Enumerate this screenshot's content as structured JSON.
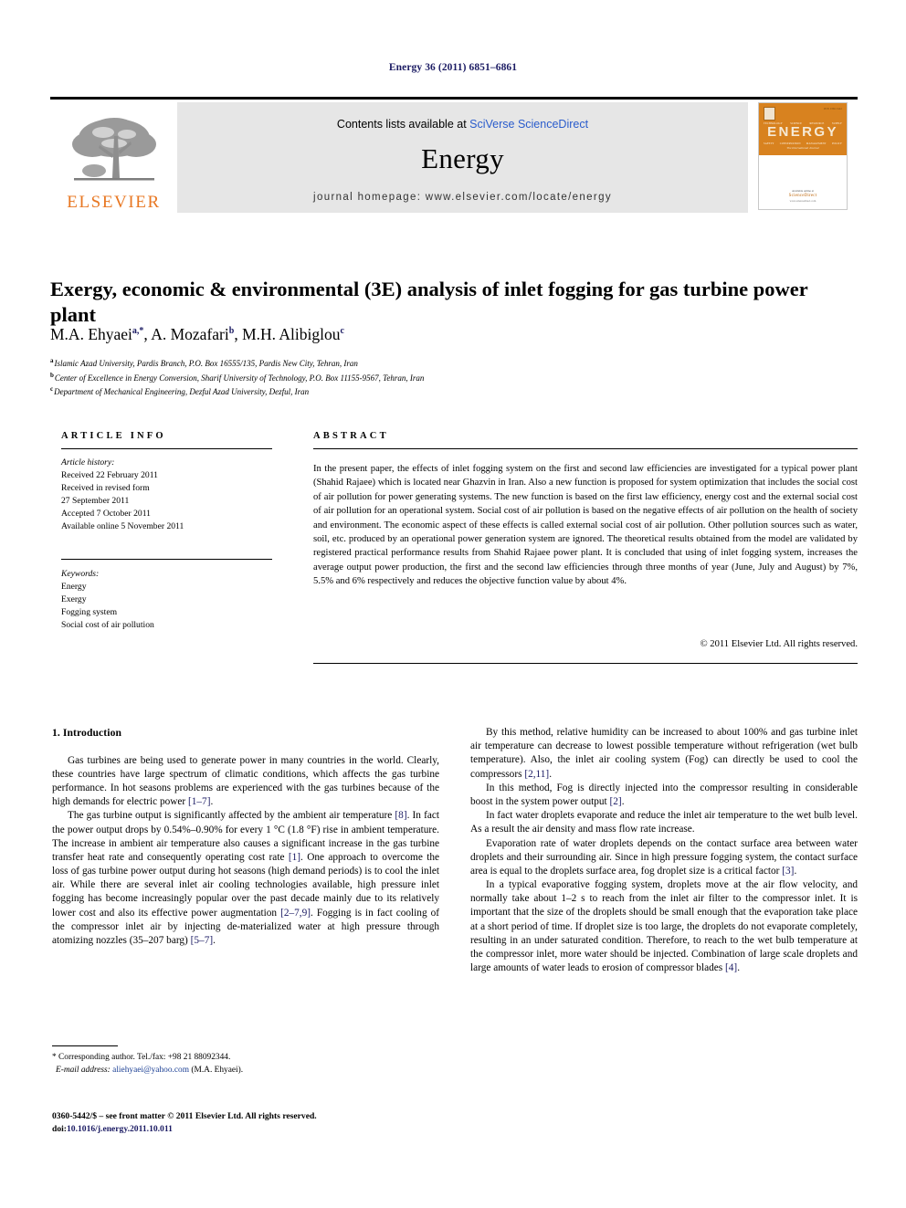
{
  "running_head": "Energy 36 (2011) 6851–6861",
  "masthead": {
    "contents_prefix": "Contents lists available at ",
    "contents_link": "SciVerse ScienceDirect",
    "journal_name": "Energy",
    "homepage": "journal homepage: www.elsevier.com/locate/energy",
    "publisher_wordmark": "ELSEVIER",
    "cover": {
      "title": "ENERGY",
      "subtitle": "The International Journal",
      "isbn_text": "ISSN 0360-5442",
      "top_row": [
        "TECHNOLOGY",
        "SCIENCE",
        "RESOURCE",
        "SUPPLY"
      ],
      "bottom_row": [
        "SAFETY",
        "CONSERVATION",
        "MANAGEMENT",
        "POLICY"
      ],
      "available_text": "Available online at",
      "sd_text": "ScienceDirect",
      "url_text": "www.sciencedirect.com"
    }
  },
  "article": {
    "title": "Exergy, economic & environmental (3E) analysis of inlet fogging for gas turbine power plant",
    "authors": [
      {
        "name": "M.A. Ehyaei",
        "marks": "a,*"
      },
      {
        "name": "A. Mozafari",
        "marks": "b"
      },
      {
        "name": "M.H. Alibiglou",
        "marks": "c"
      }
    ],
    "affiliations": [
      {
        "mark": "a",
        "text": "Islamic Azad University, Pardis Branch, P.O. Box 16555/135, Pardis New City, Tehran, Iran"
      },
      {
        "mark": "b",
        "text": "Center of Excellence in Energy Conversion, Sharif University of Technology, P.O. Box 11155-9567, Tehran, Iran"
      },
      {
        "mark": "c",
        "text": "Department of Mechanical Engineering, Dezful Azad University, Dezful, Iran"
      }
    ]
  },
  "info": {
    "label_article_info": "ARTICLE INFO",
    "label_abstract": "ABSTRACT",
    "history_title": "Article history:",
    "history_lines": [
      "Received 22 February 2011",
      "Received in revised form",
      "27 September 2011",
      "Accepted 7 October 2011",
      "Available online 5 November 2011"
    ],
    "keywords_title": "Keywords:",
    "keywords": [
      "Energy",
      "Exergy",
      "Fogging system",
      "Social cost of air pollution"
    ]
  },
  "abstract": {
    "text": "In the present paper, the effects of inlet fogging system on the first and second law efficiencies are investigated for a typical power plant (Shahid Rajaee) which is located near Ghazvin in Iran. Also a new function is proposed for system optimization that includes the social cost of air pollution for power generating systems. The new function is based on the first law efficiency, energy cost and the external social cost of air pollution for an operational system. Social cost of air pollution is based on the negative effects of air pollution on the health of society and environment. The economic aspect of these effects is called external social cost of air pollution. Other pollution sources such as water, soil, etc. produced by an operational power generation system are ignored. The theoretical results obtained from the model are validated by registered practical performance results from Shahid Rajaee power plant. It is concluded that using of inlet fogging system, increases the average output power production, the first and the second law efficiencies through three months of year (June, July and August) by 7%, 5.5% and 6% respectively and reduces the objective function value by about 4%.",
    "copyright": "© 2011 Elsevier Ltd. All rights reserved."
  },
  "body": {
    "section_heading": "1. Introduction",
    "left_paragraphs": [
      {
        "segments": [
          {
            "t": "Gas turbines are being used to generate power in many countries in the world. Clearly, these countries have large spectrum of climatic conditions, which affects the gas turbine performance. In hot seasons problems are experienced with the gas turbines because of the high demands for electric power "
          },
          {
            "t": "[1–7]",
            "ref": true
          },
          {
            "t": "."
          }
        ]
      },
      {
        "segments": [
          {
            "t": "The gas turbine output is significantly affected by the ambient air temperature "
          },
          {
            "t": "[8]",
            "ref": true
          },
          {
            "t": ". In fact the power output drops by 0.54%–0.90% for every 1 °C (1.8 °F) rise in ambient temperature. The increase in ambient air temperature also causes a significant increase in the gas turbine transfer heat rate and consequently operating cost rate "
          },
          {
            "t": "[1]",
            "ref": true
          },
          {
            "t": ". One approach to overcome the loss of gas turbine power output during hot seasons (high demand periods) is to cool the inlet air. While there are several inlet air cooling technologies available, high pressure inlet fogging has become increasingly popular over the past decade mainly due to its relatively lower cost and also its effective power augmentation "
          },
          {
            "t": "[2–7,9]",
            "ref": true
          },
          {
            "t": ". Fogging is in fact cooling of the compressor inlet air by injecting de-materialized water at high pressure through atomizing nozzles (35–207 barg) "
          },
          {
            "t": "[5–7]",
            "ref": true
          },
          {
            "t": "."
          }
        ]
      }
    ],
    "right_paragraphs": [
      {
        "segments": [
          {
            "t": "By this method, relative humidity can be increased to about 100% and gas turbine inlet air temperature can decrease to lowest possible temperature without refrigeration (wet bulb temperature). Also, the inlet air cooling system (Fog) can directly be used to cool the compressors "
          },
          {
            "t": "[2,11]",
            "ref": true
          },
          {
            "t": "."
          }
        ]
      },
      {
        "segments": [
          {
            "t": "In this method, Fog is directly injected into the compressor resulting in considerable boost in the system power output "
          },
          {
            "t": "[2]",
            "ref": true
          },
          {
            "t": "."
          }
        ]
      },
      {
        "segments": [
          {
            "t": "In fact water droplets evaporate and reduce the inlet air temperature to the wet bulb level. As a result the air density and mass flow rate increase."
          }
        ]
      },
      {
        "segments": [
          {
            "t": "Evaporation rate of water droplets depends on the contact surface area between water droplets and their surrounding air. Since in high pressure fogging system, the contact surface area is equal to the droplets surface area, fog droplet size is a critical factor "
          },
          {
            "t": "[3]",
            "ref": true
          },
          {
            "t": "."
          }
        ]
      },
      {
        "segments": [
          {
            "t": "In a typical evaporative fogging system, droplets move at the air flow velocity, and normally take about 1–2 s to reach from the inlet air filter to the compressor inlet. It is important that the size of the droplets should be small enough that the evaporation take place at a short period of time. If droplet size is too large, the droplets do not evaporate completely, resulting in an under saturated condition. Therefore, to reach to the wet bulb temperature at the compressor inlet, more water should be injected. Combination of large scale droplets and large amounts of water leads to erosion of compressor blades "
          },
          {
            "t": "[4]",
            "ref": true
          },
          {
            "t": "."
          }
        ]
      }
    ]
  },
  "footnote": {
    "corresponding": "* Corresponding author. Tel./fax: +98 21 88092344.",
    "email_label": "E-mail address:",
    "email": "aliehyaei@yahoo.com",
    "email_owner": "(M.A. Ehyaei)."
  },
  "page_footer": {
    "issn_line": "0360-5442/$ – see front matter © 2011 Elsevier Ltd. All rights reserved.",
    "doi_label": "doi:",
    "doi": "10.1016/j.energy.2011.10.011"
  },
  "colors": {
    "link_blue": "#2a5ccc",
    "ref_navy": "#1b1b63",
    "elsevier_orange": "#e87722",
    "band_gray": "#e6e6e6",
    "cover_orange": "#d8821f"
  }
}
